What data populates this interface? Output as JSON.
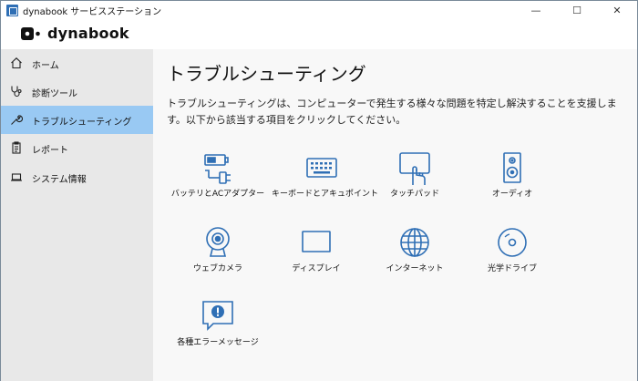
{
  "window": {
    "title": "dynabook サービスステーション",
    "controls": {
      "minimize": "—",
      "maximize": "☐",
      "close": "✕"
    }
  },
  "brand": {
    "name": "dynabook"
  },
  "sidebar": {
    "items": [
      {
        "label": "ホーム",
        "icon": "home-icon",
        "active": false
      },
      {
        "label": "診断ツール",
        "icon": "stethoscope-icon",
        "active": false
      },
      {
        "label": "トラブルシューティング",
        "icon": "wrench-icon",
        "active": true
      },
      {
        "label": "レポート",
        "icon": "clipboard-icon",
        "active": false
      },
      {
        "label": "システム情報",
        "icon": "laptop-icon",
        "active": false
      }
    ]
  },
  "main": {
    "title": "トラブルシューティング",
    "description": "トラブルシューティングは、コンピューターで発生する様々な問題を特定し解決することを支援します。以下から該当する項目をクリックしてください。",
    "tiles": [
      {
        "label": "バッテリとACアダプター",
        "icon": "battery-plug-icon"
      },
      {
        "label": "キーボードとアキュポイント",
        "icon": "keyboard-icon"
      },
      {
        "label": "タッチパッド",
        "icon": "touchpad-icon"
      },
      {
        "label": "オーディオ",
        "icon": "speaker-icon"
      },
      {
        "label": "ウェブカメラ",
        "icon": "webcam-icon"
      },
      {
        "label": "ディスプレイ",
        "icon": "display-icon"
      },
      {
        "label": "インターネット",
        "icon": "globe-icon"
      },
      {
        "label": "光学ドライブ",
        "icon": "disc-icon"
      },
      {
        "label": "各種エラーメッセージ",
        "icon": "error-message-icon"
      }
    ]
  },
  "colors": {
    "accent": "#2f6fb5",
    "active_nav": "#99c9f3",
    "sidebar_bg": "#e8e8e8",
    "main_bg": "#f8f8f8"
  }
}
